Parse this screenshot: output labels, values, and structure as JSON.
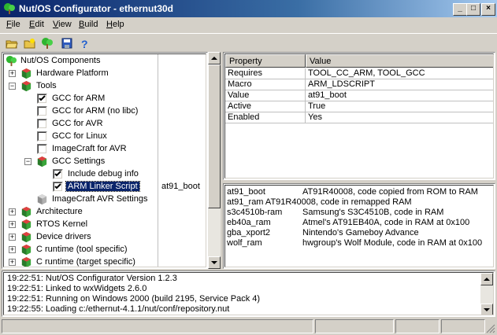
{
  "window": {
    "title": "Nut/OS Configurator - ethernut30d"
  },
  "menu": [
    {
      "label": "File",
      "accel": "F",
      "rest": "ile"
    },
    {
      "label": "Edit",
      "accel": "E",
      "rest": "dit"
    },
    {
      "label": "View",
      "accel": "V",
      "rest": "iew"
    },
    {
      "label": "Build",
      "accel": "B",
      "rest": "uild"
    },
    {
      "label": "Help",
      "accel": "H",
      "rest": "elp"
    }
  ],
  "tree": {
    "root": "Nut/OS Components",
    "items": [
      {
        "label": "Hardware Platform"
      },
      {
        "label": "Tools"
      },
      {
        "label": "GCC for ARM"
      },
      {
        "label": "GCC for ARM (no libc)"
      },
      {
        "label": "GCC for AVR"
      },
      {
        "label": "GCC for Linux"
      },
      {
        "label": "ImageCraft for AVR"
      },
      {
        "label": "GCC Settings"
      },
      {
        "label": "Include debug info"
      },
      {
        "label": "ARM Linker Script",
        "value": "at91_boot"
      },
      {
        "label": "ImageCraft AVR Settings"
      },
      {
        "label": "Architecture"
      },
      {
        "label": "RTOS Kernel"
      },
      {
        "label": "Device drivers"
      },
      {
        "label": "C runtime (tool specific)"
      },
      {
        "label": "C runtime (target specific)"
      }
    ]
  },
  "properties": {
    "headers": [
      "Property",
      "Value"
    ],
    "rows": [
      [
        "Requires",
        "TOOL_CC_ARM, TOOL_GCC"
      ],
      [
        "Macro",
        "ARM_LDSCRIPT"
      ],
      [
        "Value",
        "at91_boot"
      ],
      [
        "Active",
        "True"
      ],
      [
        "Enabled",
        "Yes"
      ]
    ]
  },
  "choices": [
    [
      "at91_boot",
      "AT91R40008, code copied from ROM to RAM"
    ],
    [
      "at91_ram AT91R40008, code in remapped RAM",
      ""
    ],
    [
      "s3c4510b-ram",
      "Samsung's S3C4510B, code in RAM"
    ],
    [
      "eb40a_ram",
      "Atmel's AT91EB40A, code in RAM at 0x100"
    ],
    [
      "gba_xport2",
      "Nintendo's Gameboy Advance"
    ],
    [
      "wolf_ram",
      "hwgroup's Wolf Module, code in RAM at 0x100"
    ]
  ],
  "log": [
    "19:22:51: Nut/OS Configurator Version 1.2.3",
    "19:22:51: Linked to wxWidgets 2.6.0",
    "19:22:51: Running on Windows 2000 (build 2195, Service Pack 4)",
    "19:22:55: Loading c:/ethernut-4.1.1/nut/conf/repository.nut"
  ],
  "colors": {
    "title_start": "#0a246a",
    "title_end": "#a6caf0",
    "selection": "#0a246a",
    "face": "#d4d0c8"
  }
}
